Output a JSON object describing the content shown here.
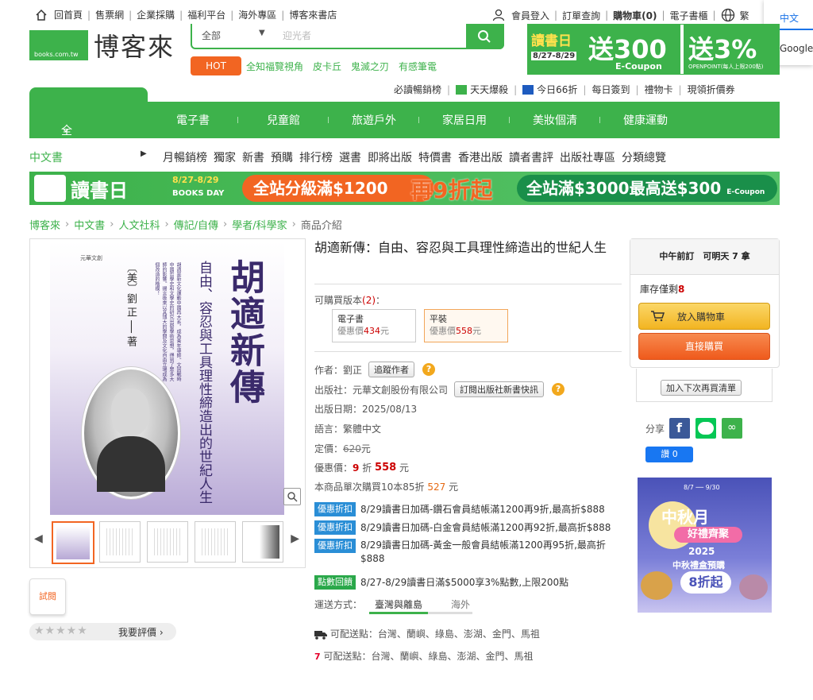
{
  "topnav": {
    "home": "回首頁",
    "items": [
      "售票網",
      "企業採購",
      "福利平台",
      "海外專區",
      "博客來書店"
    ],
    "right": [
      "會員登入",
      "訂單查詢",
      "購物車(0)",
      "電子書櫃",
      "繁"
    ]
  },
  "translate": {
    "lang": "中文",
    "google": "Google"
  },
  "logo": {
    "site": "books.com.tw",
    "brand": "博客來"
  },
  "search": {
    "category": "全部",
    "placeholder": "迎光者"
  },
  "hot": {
    "label": "HOT",
    "links": [
      "全知福覽視角",
      "皮卡丘",
      "鬼滅之刃",
      "有感筆電"
    ]
  },
  "top_banner": {
    "t1": "讀書日",
    "date": "8/27-8/29",
    "v1": "送300",
    "s1": "E-Coupon",
    "v2": "送3%",
    "s2": "OPENPOINT(每人上限200點)"
  },
  "sublinks": [
    "必讀暢銷榜",
    "天天爆殺",
    "今日66折",
    "每日簽到",
    "禮物卡",
    "現領折價券"
  ],
  "allcat": "全站分類",
  "mainnav": [
    "電子書",
    "兒童館",
    "旅遊戶外",
    "家居日用",
    "美妝個清",
    "健康運動"
  ],
  "catline": {
    "current": "中文書",
    "links": [
      "月暢銷榜",
      "獨家",
      "新書",
      "預購",
      "排行榜",
      "選書",
      "即將出版",
      "特價書",
      "香港出版",
      "讀者書評",
      "出版社專區",
      "分類總覽"
    ]
  },
  "wide_banner": {
    "title": "讀書日",
    "date": "8/27-8/29",
    "sub": "BOOKS DAY",
    "p1": "全站分級滿$1200",
    "p2": "再9折起",
    "p3": "全站滿$3000最高送$300",
    "p3s": "E-Coupon"
  },
  "breadcrumb": [
    "博客來",
    "中文書",
    "人文社科",
    "傳記/自傳",
    "學者/科學家"
  ],
  "breadcrumb_last": "商品介紹",
  "cover": {
    "publisher": "元華文創",
    "title": "胡適新傳",
    "subtitle": "自由、容忍與工具理性締造出的世紀人生",
    "author": "〔美〕劉 正 ── 著",
    "blurb": "胡適是新文化運動中國再大系，成為青年導師。文因戰時中國哲學史和文學史的研究出發學術思想，得到了眾多大師的影響。揚言後來以其博大的學問及文化自由立場成為個改造的楷模！"
  },
  "trial": "試閱",
  "rating": {
    "stars": "★★★★★",
    "label": "我要評價 ›"
  },
  "product": {
    "title": "胡適新傳：自由、容忍與工具理性締造出的世紀人生",
    "versions_label": "可購買版本",
    "versions_count": "(2)",
    "versions_suffix": "：",
    "versions": [
      {
        "name": "電子書",
        "price_label": "優惠價",
        "price": "434",
        "unit": "元"
      },
      {
        "name": "平裝",
        "price_label": "優惠價",
        "price": "558",
        "unit": "元"
      }
    ],
    "author_label": "作者：",
    "author": "劉正",
    "follow_author": "追蹤作者",
    "publisher_label": "出版社：",
    "publisher": "元華文創股份有限公司",
    "subscribe": "訂閱出版社新書快訊",
    "date_label": "出版日期：",
    "date": "2025/08/13",
    "lang_label": "語言：",
    "lang": "繁體中文",
    "list_label": "定價：",
    "list_price": "620",
    "list_unit": "元",
    "sale_label": "優惠價：",
    "discount": "9",
    "discount_unit": "折",
    "sale_price": "558",
    "sale_unit": "元",
    "bulk": "本商品單次購買10本85折",
    "bulk_price": "527",
    "bulk_unit": "元"
  },
  "promos": [
    {
      "tag": "優惠折扣",
      "text": "8/29讀書日加碼-鑽石會員結帳滿1200再9折,最高折$888"
    },
    {
      "tag": "優惠折扣",
      "text": "8/29讀書日加碼-白金會員結帳滿1200再92折,最高折$888"
    },
    {
      "tag": "優惠折扣",
      "text": "8/29讀書日加碼-黃金一般會員結帳滿1200再95折,最高折$888"
    },
    {
      "tag": "點數回饋",
      "text": "8/27-8/29讀書日滿$5000享3%點數,上限200點"
    }
  ],
  "shipping": {
    "label": "運送方式：",
    "tab1": "臺灣與離島",
    "tab2": "海外",
    "line1_label": "可配送點：",
    "line1": "台灣、蘭嶼、綠島、澎湖、金門、馬祖",
    "line2_label": "可配送點：",
    "line2": "台灣、蘭嶼、綠島、澎湖、金門、馬祖"
  },
  "buybox": {
    "header": "中午前訂　可明天 7 拿",
    "stock_label": "庫存僅剩",
    "stock": "8",
    "cart": "放入購物車",
    "buy": "直接購買",
    "wish": "加入下次再買清單"
  },
  "share": {
    "label": "分享",
    "like": "讚 0"
  },
  "ad": {
    "date": "8/7 ── 9/30",
    "t1": "中秋月",
    "t2": "好禮齊聚",
    "t3": "2025",
    "t4": "中秋禮盒預購",
    "t5": "8折起"
  }
}
